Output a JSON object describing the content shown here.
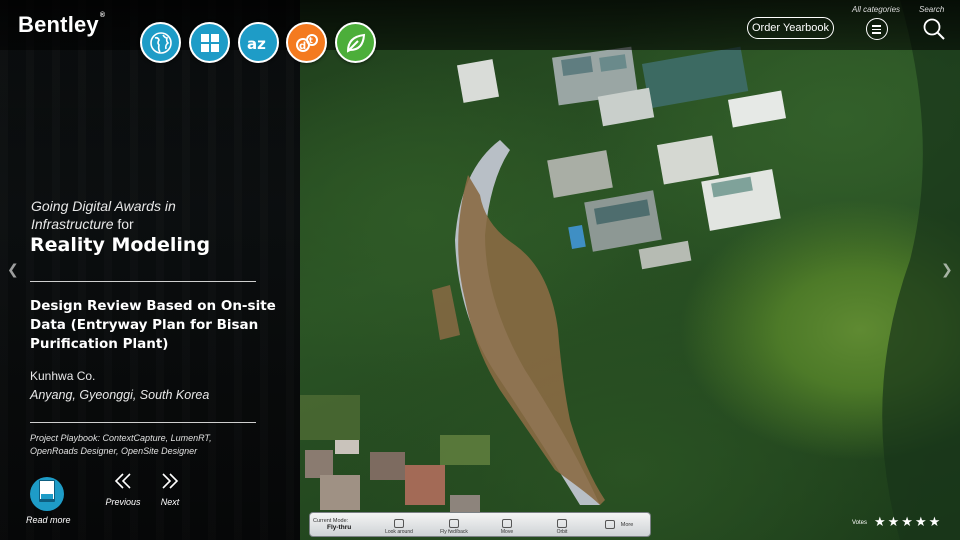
{
  "brand": {
    "logo_text": "Bentley",
    "trademark": "®"
  },
  "categories": [
    {
      "icon": "globe-icon",
      "color": "#1e9cc7"
    },
    {
      "icon": "grid-icon",
      "color": "#1e9cc7"
    },
    {
      "icon": "az-icon",
      "color": "#1e9cc7"
    },
    {
      "icon": "dt-icon",
      "color": "#f47a1f"
    },
    {
      "icon": "leaf-icon",
      "color": "#4cae3a"
    }
  ],
  "header": {
    "order_label": "Order Yearbook",
    "all_categories_label": "All categories",
    "search_label": "Search"
  },
  "award": {
    "prefix": "Going Digital Awards in Infrastructure",
    "for": "for",
    "category": "Reality Modeling"
  },
  "project": {
    "title": "Design Review Based on On-site Data (Entryway Plan for Bisan Purification Plant)",
    "organization": "Kunhwa Co.",
    "location": "Anyang, Gyeonggi, South Korea",
    "playbook": "Project Playbook: ContextCapture, LumenRT, OpenRoads Designer, OpenSite Designer"
  },
  "nav": {
    "read_more": "Read more",
    "previous": "Previous",
    "next": "Next"
  },
  "toolbar": {
    "mode_caption": "Current Mode:",
    "mode_value": "Fly-thru",
    "look_around": "Look around",
    "fly_fwd": "Fly fwd/back",
    "move": "Move",
    "orbit": "Orbit",
    "more": "More"
  },
  "rating": {
    "label": "Votes",
    "stars": "★★★★★"
  },
  "accent_colors": {
    "blue": "#1e9cc7",
    "orange": "#f47a1f",
    "green": "#4cae3a"
  }
}
